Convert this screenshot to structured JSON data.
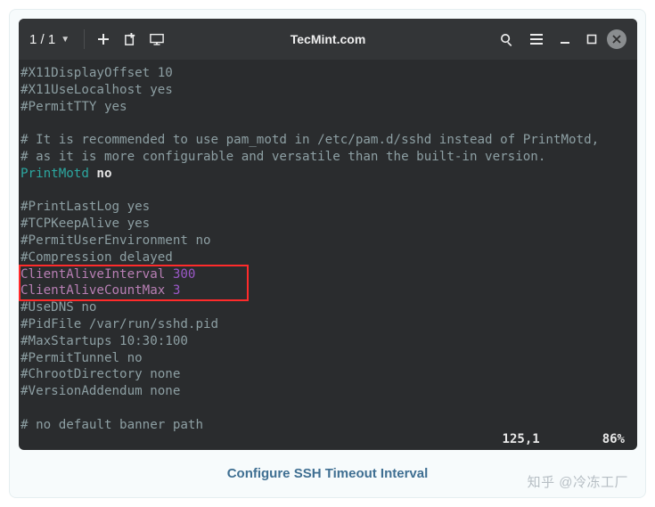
{
  "window": {
    "tab_counter": "1 / 1",
    "title": "TecMint.com"
  },
  "editor": {
    "lines": [
      {
        "segments": [
          {
            "t": "#X11DisplayOffset 10",
            "c": "cmt"
          }
        ]
      },
      {
        "segments": [
          {
            "t": "#X11UseLocalhost yes",
            "c": "cmt"
          }
        ]
      },
      {
        "segments": [
          {
            "t": "#PermitTTY yes",
            "c": "cmt"
          }
        ]
      },
      {
        "segments": [
          {
            "t": "",
            "c": ""
          }
        ]
      },
      {
        "segments": [
          {
            "t": "# It is recommended to use pam_motd in /etc/pam.d/sshd instead of PrintMotd,",
            "c": "cmt"
          }
        ]
      },
      {
        "segments": [
          {
            "t": "# as it is more configurable and versatile than the built-in version.",
            "c": "cmt"
          }
        ]
      },
      {
        "segments": [
          {
            "t": "PrintMotd",
            "c": "kw"
          },
          {
            "t": " ",
            "c": ""
          },
          {
            "t": "no",
            "c": "val"
          }
        ]
      },
      {
        "segments": [
          {
            "t": "",
            "c": ""
          }
        ]
      },
      {
        "segments": [
          {
            "t": "#PrintLastLog yes",
            "c": "cmt"
          }
        ]
      },
      {
        "segments": [
          {
            "t": "#TCPKeepAlive yes",
            "c": "cmt"
          }
        ]
      },
      {
        "segments": [
          {
            "t": "#PermitUserEnvironment no",
            "c": "cmt"
          }
        ]
      },
      {
        "segments": [
          {
            "t": "#Compression delayed",
            "c": "cmt"
          }
        ]
      },
      {
        "segments": [
          {
            "t": "ClientAliveInterval",
            "c": "hl-key"
          },
          {
            "t": " ",
            "c": ""
          },
          {
            "t": "300",
            "c": "hl-num"
          }
        ],
        "hl": true
      },
      {
        "segments": [
          {
            "t": "ClientAliveCountMax",
            "c": "hl-key"
          },
          {
            "t": " ",
            "c": ""
          },
          {
            "t": "3",
            "c": "hl-num"
          }
        ],
        "hl": true
      },
      {
        "segments": [
          {
            "t": "#UseDNS no",
            "c": "cmt"
          }
        ]
      },
      {
        "segments": [
          {
            "t": "#PidFile /var/run/sshd.pid",
            "c": "cmt"
          }
        ]
      },
      {
        "segments": [
          {
            "t": "#MaxStartups 10:30:100",
            "c": "cmt"
          }
        ]
      },
      {
        "segments": [
          {
            "t": "#PermitTunnel no",
            "c": "cmt"
          }
        ]
      },
      {
        "segments": [
          {
            "t": "#ChrootDirectory none",
            "c": "cmt"
          }
        ]
      },
      {
        "segments": [
          {
            "t": "#VersionAddendum none",
            "c": "cmt"
          }
        ]
      },
      {
        "segments": [
          {
            "t": "",
            "c": ""
          }
        ]
      },
      {
        "segments": [
          {
            "t": "# no default banner path",
            "c": "cmt"
          }
        ]
      }
    ],
    "status_position": "125,1",
    "status_percent": "86%"
  },
  "caption": "Configure SSH Timeout Interval",
  "watermark": "知乎 @冷冻工厂"
}
